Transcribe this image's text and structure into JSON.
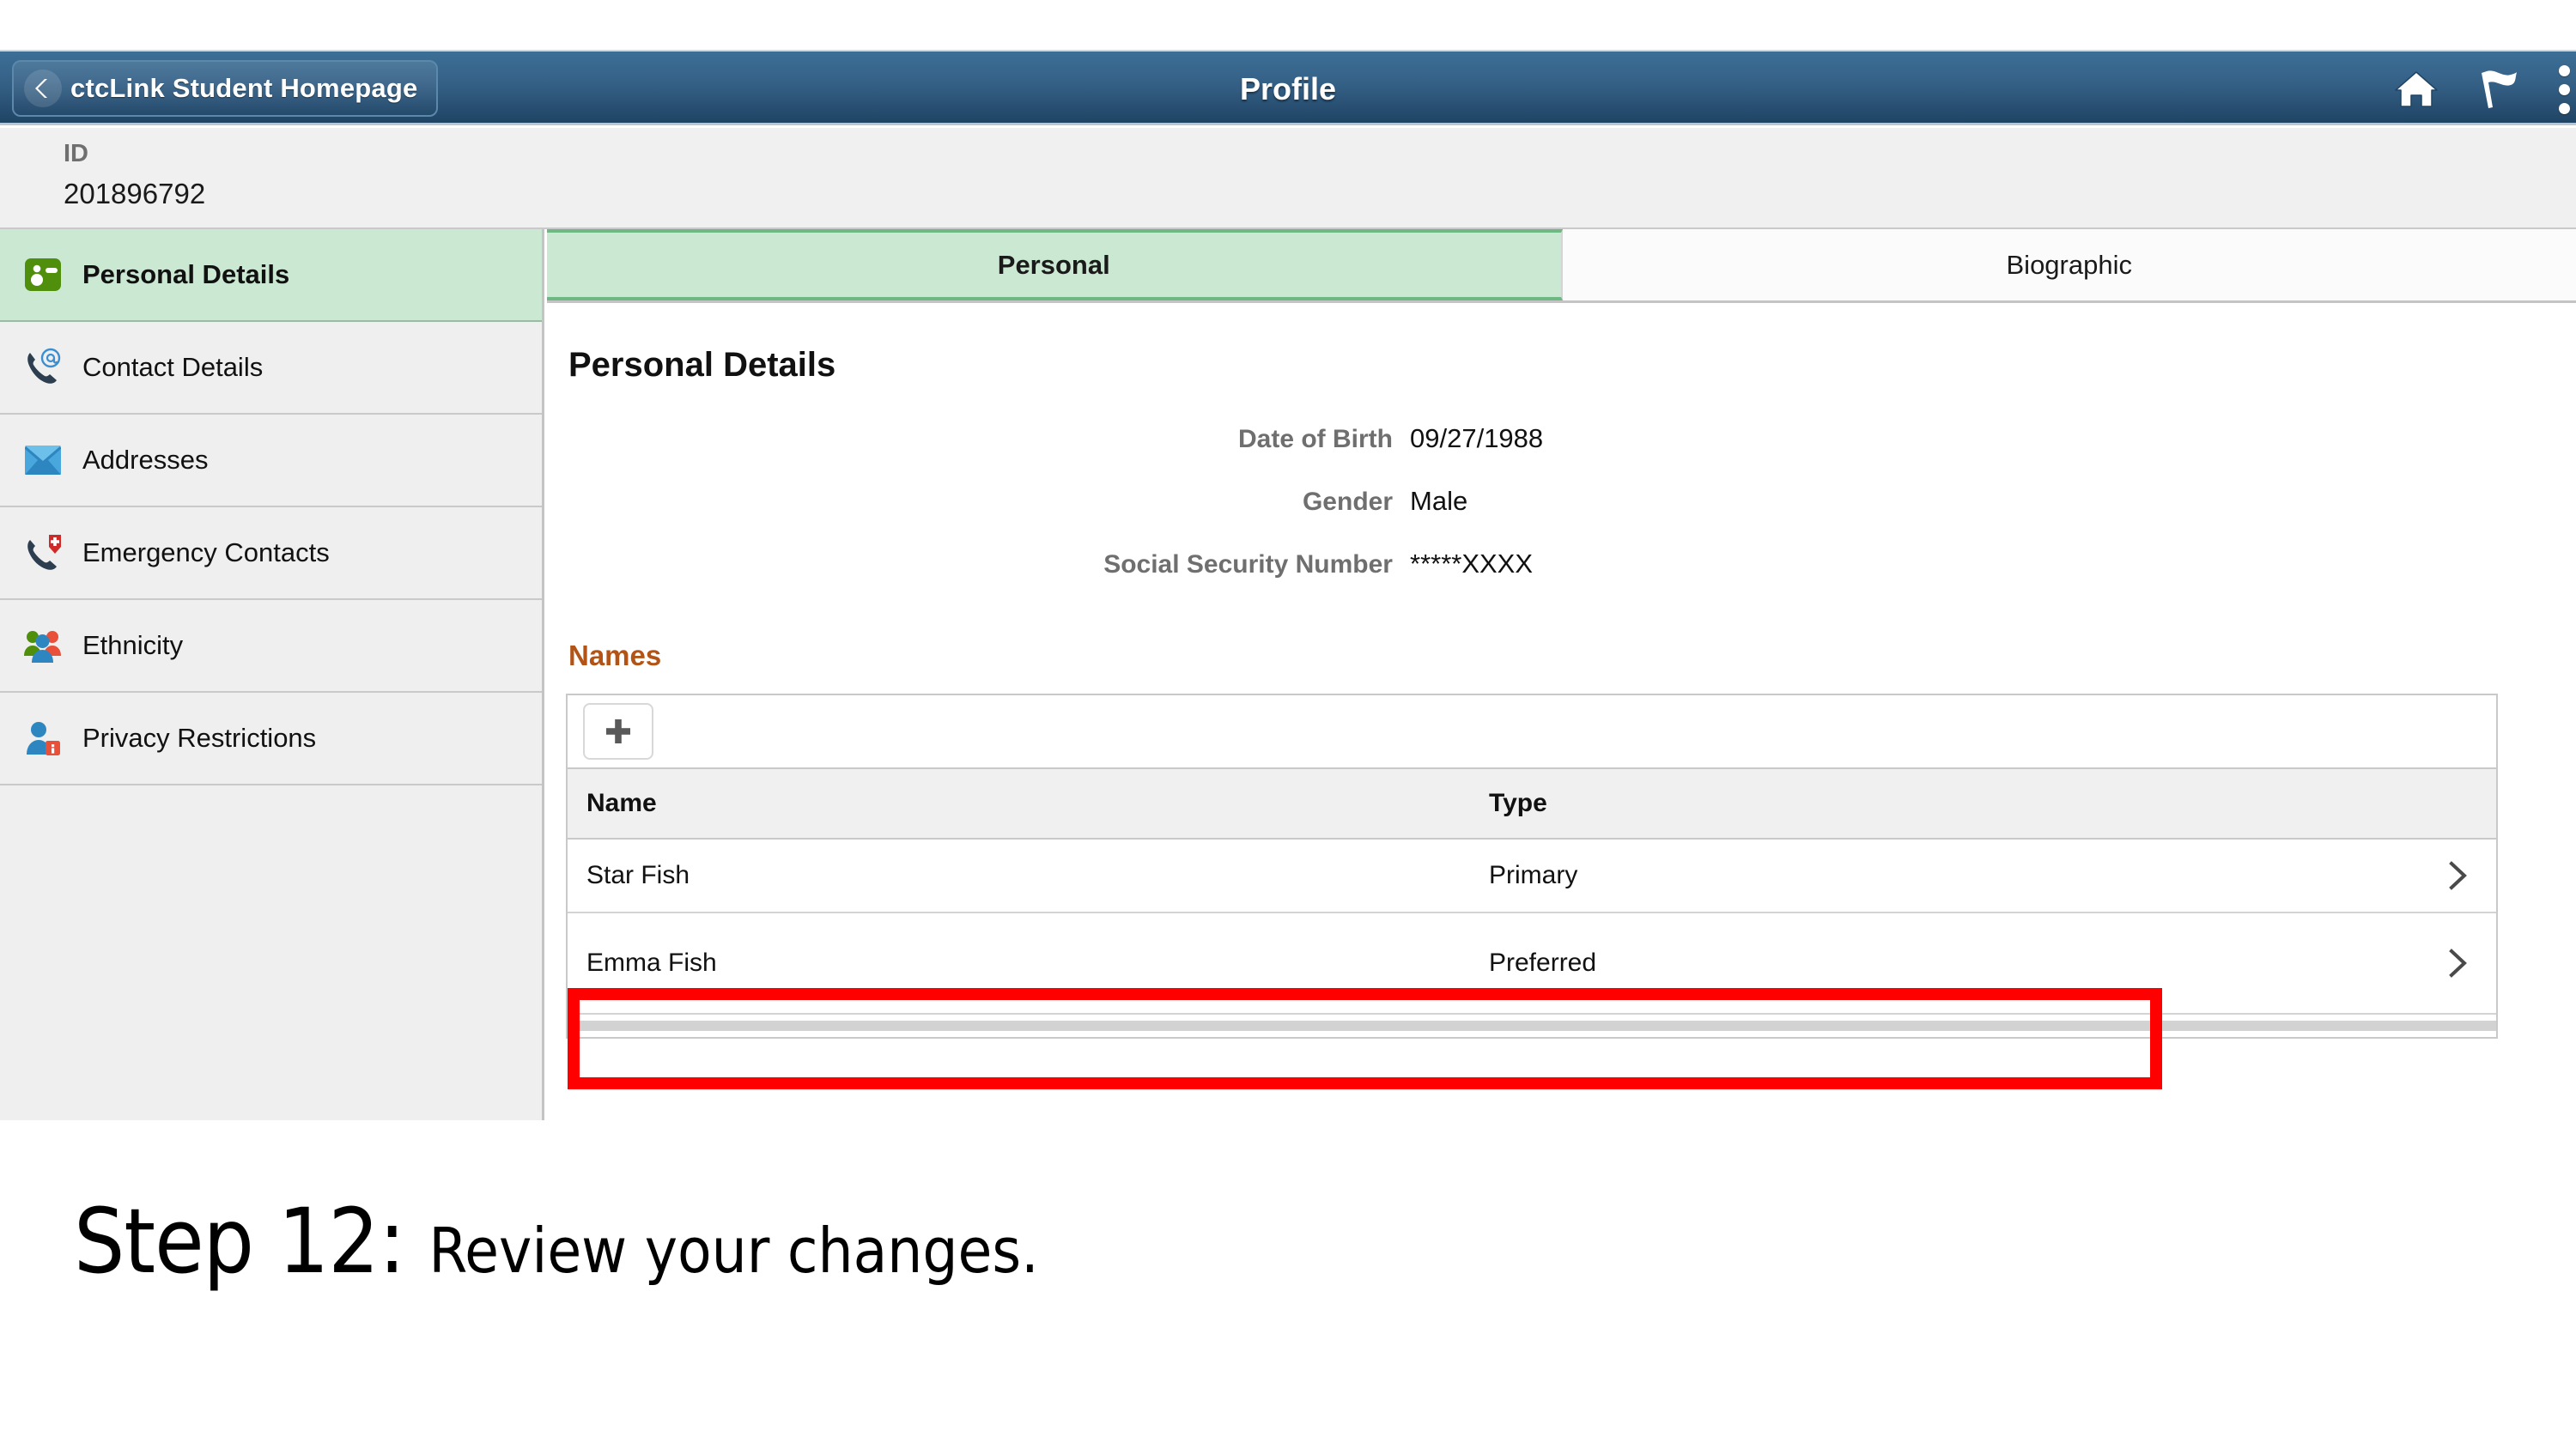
{
  "banner": {
    "back_label": "ctcLink Student Homepage",
    "title": "Profile",
    "icons": {
      "back": "back-chevron-icon",
      "home": "home-icon",
      "flag": "flag-icon",
      "more": "more-options-icon"
    }
  },
  "subheader": {
    "id_label": "ID",
    "id_value": "201896792"
  },
  "sidebar": {
    "items": [
      {
        "label": "Personal Details",
        "icon": "id-card-icon",
        "active": true
      },
      {
        "label": "Contact Details",
        "icon": "phone-at-icon",
        "active": false
      },
      {
        "label": "Addresses",
        "icon": "envelope-icon",
        "active": false
      },
      {
        "label": "Emergency Contacts",
        "icon": "phone-medical-icon",
        "active": false
      },
      {
        "label": "Ethnicity",
        "icon": "people-group-icon",
        "active": false
      },
      {
        "label": "Privacy Restrictions",
        "icon": "person-info-icon",
        "active": false
      }
    ]
  },
  "tabs": [
    {
      "label": "Personal",
      "active": true
    },
    {
      "label": "Biographic",
      "active": false
    }
  ],
  "main": {
    "section_title": "Personal Details",
    "fields": [
      {
        "label": "Date of Birth",
        "value": "09/27/1988"
      },
      {
        "label": "Gender",
        "value": "Male"
      },
      {
        "label": "Social Security Number",
        "value": "*****XXXX"
      }
    ],
    "names": {
      "title": "Names",
      "add_button_icon": "plus-icon",
      "columns": [
        "Name",
        "Type"
      ],
      "rows": [
        {
          "name": "Star Fish",
          "type": "Primary",
          "chevron": "chevron-right-icon",
          "highlighted": false
        },
        {
          "name": "Emma Fish",
          "type": "Preferred",
          "chevron": "chevron-right-icon",
          "highlighted": true
        }
      ]
    }
  },
  "annotation": {
    "highlight_color": "#fe0000",
    "step": "Step 12:",
    "description": "Review your changes."
  }
}
